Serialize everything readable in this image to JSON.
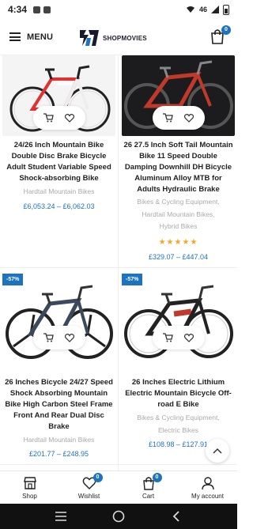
{
  "status_bar": {
    "time": "4:34",
    "network": "46"
  },
  "header": {
    "menu_label": "MENU",
    "logo_text": "SHOPMOVIES",
    "cart_count": "0"
  },
  "products": [
    {
      "title": "24/26 Inch Mountain Bike Double Disc Brake Bicycle Adult Student Variable Speed Shock-absorbing Bike",
      "categories": [
        "Hardtail Mountain Bikes"
      ],
      "price": "£6,053.24 – £6,062.03",
      "sale": "",
      "rating": ""
    },
    {
      "title": "26 27.5 Inch Soft Tail Mountain Bike 11 Speed Double Damping Downhill DH Bicycle Aluminum Alloy MTB for Adults Hydraulic Brake",
      "categories": [
        "Bikes & Cycling Equipment,",
        "Hardtail Mountain Bikes,",
        "Hybrid Bikes"
      ],
      "price": "£329.07 – £447.04",
      "sale": "",
      "rating": "★★★★★"
    },
    {
      "title": "26 Inches Bicycle 24/27 Speed Shock Absorbing Mountain Bike High Carbon Steel Frame Front And Rear Dual Disc Brake",
      "categories": [
        "Hardtail Mountain Bikes"
      ],
      "price": "£201.77 – £248.95",
      "sale": "-57%",
      "rating": ""
    },
    {
      "title": "26 Inches Electric Lithium Electric Mountain Bicycle Off-road E Bike",
      "categories": [
        "Bikes & Cycling Equipment,",
        "Electric Bikes"
      ],
      "price": "£108.98 – £127.91",
      "sale": "-57%",
      "rating": ""
    }
  ],
  "bottom_nav": [
    {
      "label": "Shop",
      "icon": "shop-icon"
    },
    {
      "label": "Wishlist",
      "icon": "heart-icon",
      "count": "0"
    },
    {
      "label": "Cart",
      "icon": "cart-icon",
      "count": "0"
    },
    {
      "label": "My account",
      "icon": "user-icon"
    }
  ],
  "colors": {
    "accent": "#1e73be",
    "stars": "#f5a623",
    "category": "#aaaaaa"
  }
}
